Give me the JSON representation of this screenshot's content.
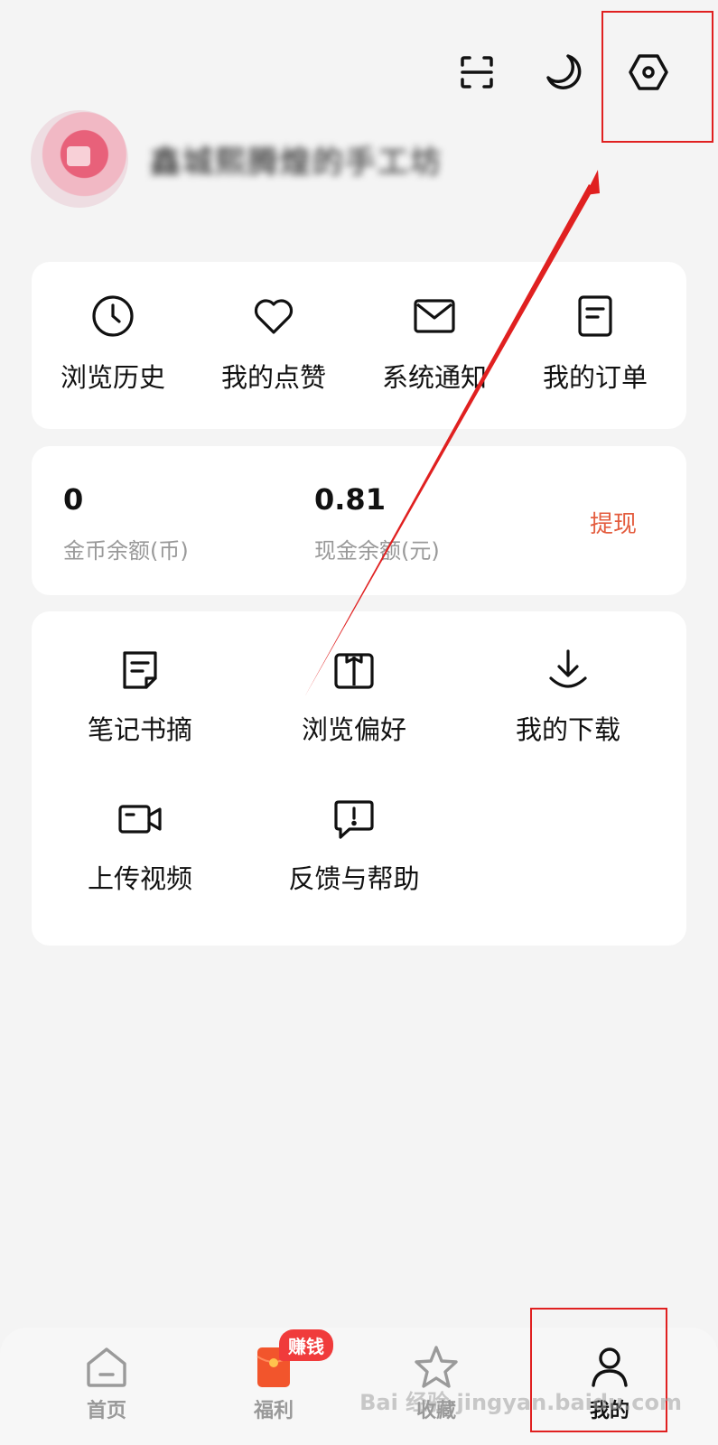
{
  "header": {
    "scan_icon": "scan-icon",
    "night_icon": "moon-icon",
    "settings_icon": "settings-icon"
  },
  "profile": {
    "username": "鑫城熙腾煌的手工坊"
  },
  "quick_actions": [
    {
      "label": "浏览历史",
      "icon": "clock-icon"
    },
    {
      "label": "我的点赞",
      "icon": "heart-icon"
    },
    {
      "label": "系统通知",
      "icon": "mail-icon"
    },
    {
      "label": "我的订单",
      "icon": "order-icon"
    }
  ],
  "wallet": {
    "coins_value": "0",
    "coins_label": "金币余额(币)",
    "cash_value": "0.81",
    "cash_label": "现金余额(元)",
    "withdraw_label": "提现"
  },
  "tools": [
    {
      "label": "笔记书摘",
      "icon": "note-icon"
    },
    {
      "label": "浏览偏好",
      "icon": "book-icon"
    },
    {
      "label": "我的下载",
      "icon": "download-icon"
    },
    {
      "label": "上传视频",
      "icon": "video-icon"
    },
    {
      "label": "反馈与帮助",
      "icon": "feedback-icon"
    }
  ],
  "tabbar": {
    "tabs": [
      {
        "label": "首页",
        "icon": "home-icon"
      },
      {
        "label": "福利",
        "icon": "red-envelope-icon",
        "badge": "赚钱"
      },
      {
        "label": "收藏",
        "icon": "star-icon"
      },
      {
        "label": "我的",
        "icon": "person-icon",
        "active": true
      }
    ]
  },
  "colors": {
    "accent": "#e45d3f",
    "annotation": "#e02020",
    "badge": "#f03b3b",
    "background": "#f4f4f4"
  },
  "watermark": "Bai 经验 jingyan.baidu.com"
}
